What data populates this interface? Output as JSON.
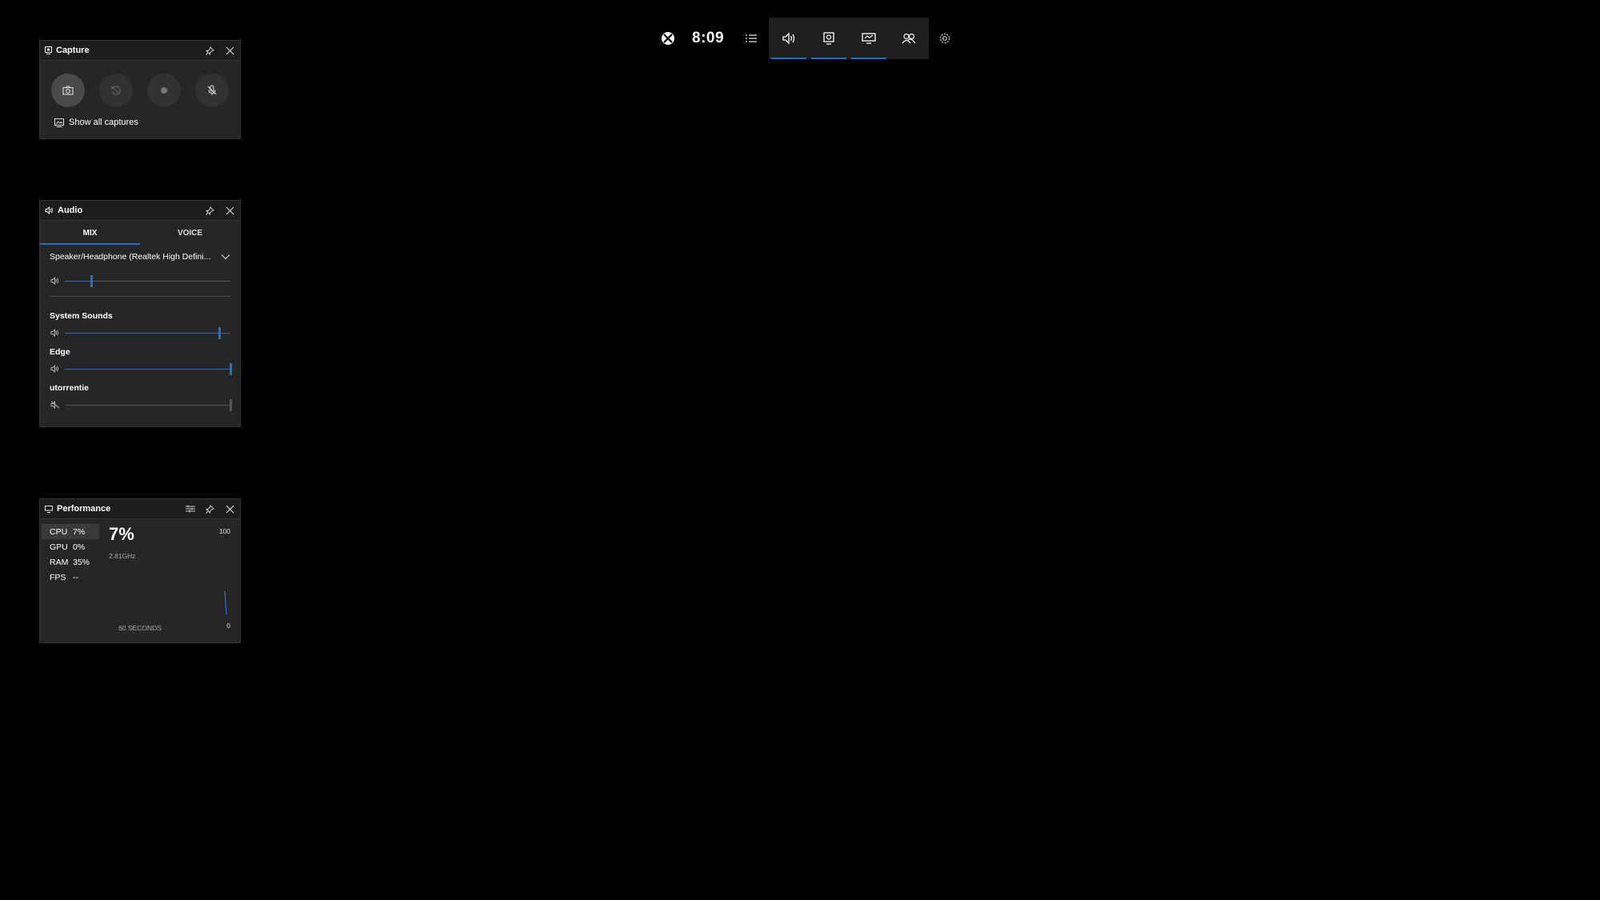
{
  "topbar": {
    "time": "8:09",
    "icons": [
      "xbox-icon",
      "widget-menu-icon",
      "audio-icon",
      "capture-icon",
      "performance-icon",
      "social-icon",
      "settings-icon"
    ],
    "accent": "#1f6fd1"
  },
  "capture": {
    "title": "Capture",
    "show_all": "Show all captures",
    "buttons": [
      "screenshot-icon",
      "record-last-icon",
      "record-icon",
      "mic-off-icon"
    ]
  },
  "audio": {
    "title": "Audio",
    "tabs": [
      "MIX",
      "VOICE"
    ],
    "active_tab": "MIX",
    "device": "Speaker/Headphone (Realtek High Defini...",
    "master_volume": 0.16,
    "apps": [
      {
        "name": "System Sounds",
        "volume": 0.93,
        "muted": false
      },
      {
        "name": "Edge",
        "volume": 1.0,
        "muted": false
      },
      {
        "name": "utorrentie",
        "volume": 1.0,
        "muted": true
      }
    ]
  },
  "performance": {
    "title": "Performance",
    "metrics": [
      {
        "label": "CPU",
        "value": "7%"
      },
      {
        "label": "GPU",
        "value": "0%"
      },
      {
        "label": "RAM",
        "value": "35%"
      },
      {
        "label": "FPS",
        "value": "--"
      }
    ],
    "selected": "CPU",
    "big_value": "7%",
    "frequency": "2.81GHz",
    "axis_max": "100",
    "axis_min": "0",
    "window_label": "60 SECONDS"
  }
}
